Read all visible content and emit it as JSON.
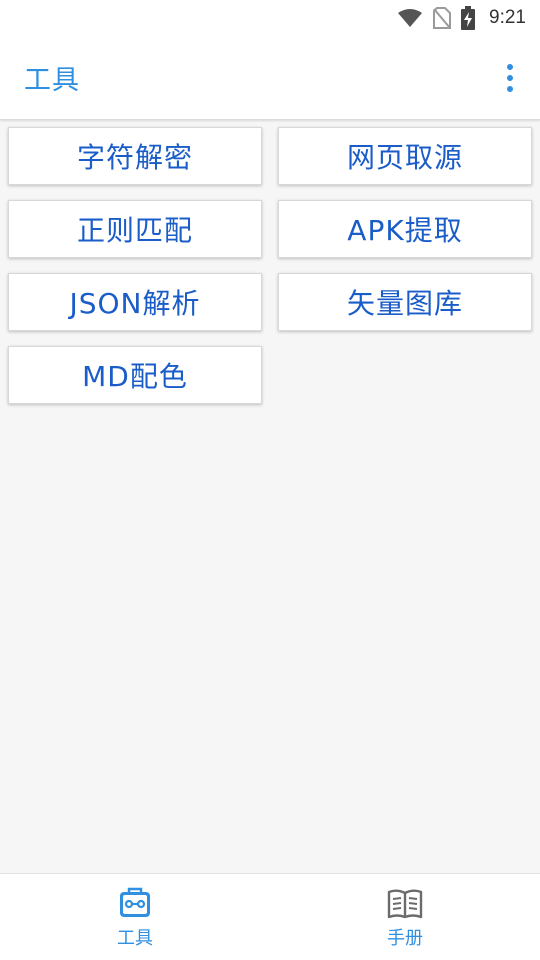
{
  "status_bar": {
    "time": "9:21",
    "icons": [
      "wifi-icon",
      "no-sim-icon",
      "battery-charging-icon"
    ]
  },
  "app_bar": {
    "title": "工具",
    "menu_icon": "more-vert-icon"
  },
  "tools": [
    {
      "label": "字符解密"
    },
    {
      "label": "网页取源"
    },
    {
      "label": "正则匹配"
    },
    {
      "label": "APK提取"
    },
    {
      "label": "JSON解析"
    },
    {
      "label": "矢量图库"
    },
    {
      "label": "MD配色"
    }
  ],
  "bottom_nav": {
    "items": [
      {
        "label": "工具",
        "icon": "toolbox-icon",
        "selected": true
      },
      {
        "label": "手册",
        "icon": "book-icon",
        "selected": false
      }
    ]
  },
  "colors": {
    "accent": "#2f8fe0",
    "button_text": "#1a5cc8",
    "background": "#f6f6f6",
    "inactive_icon": "#6b6b6b"
  }
}
